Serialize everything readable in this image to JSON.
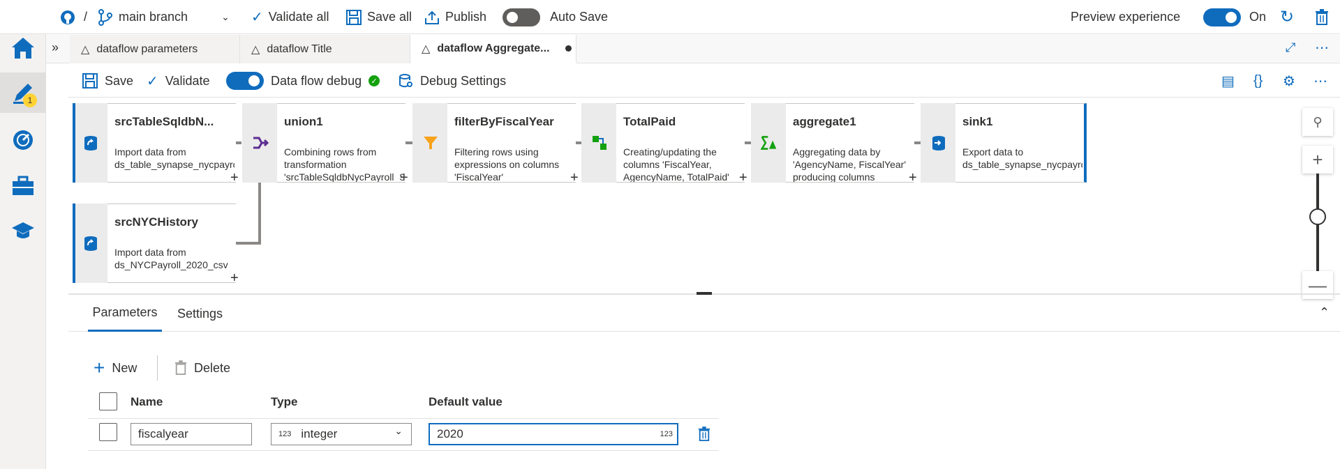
{
  "topbar": {
    "separator": "/",
    "branch": "main branch",
    "validate_all": "Validate all",
    "save_all": "Save all",
    "publish": "Publish",
    "auto_save": "Auto Save",
    "preview_experience": "Preview experience",
    "preview_state": "On"
  },
  "rail": {
    "badge_count": "1"
  },
  "tabs": [
    {
      "label": "dataflow parameters"
    },
    {
      "label": "dataflow Title"
    },
    {
      "label": "dataflow Aggregate..."
    }
  ],
  "toolbar": {
    "save": "Save",
    "validate": "Validate",
    "data_flow_debug": "Data flow debug",
    "debug_settings": "Debug Settings"
  },
  "nodes": [
    {
      "title": "srcTableSqldbN...",
      "desc": "Import data from ds_table_synapse_nycpayroll_summary"
    },
    {
      "title": "union1",
      "desc": "Combining rows from transformation 'srcTableSqldbNycPayroll_Summary, NYCHistory'"
    },
    {
      "title": "filterByFiscalYear",
      "desc": "Filtering rows using expressions on columns 'FiscalYear'"
    },
    {
      "title": "TotalPaid",
      "desc": "Creating/updating the columns 'FiscalYear, AgencyName, TotalPaid'"
    },
    {
      "title": "aggregate1",
      "desc": "Aggregating data by 'AgencyName, FiscalYear' producing columns 'TotalPaid'"
    },
    {
      "title": "sink1",
      "desc": "Export data to ds_table_synapse_nycpayroll_summary"
    },
    {
      "title": "srcNYCHistory",
      "desc": "Import data from ds_NYCPayroll_2020_csv"
    }
  ],
  "panel": {
    "tab_parameters": "Parameters",
    "tab_settings": "Settings",
    "new": "New",
    "delete": "Delete",
    "col_name": "Name",
    "col_type": "Type",
    "col_default": "Default value",
    "rows": [
      {
        "name": "fiscalyear",
        "type_badge": "123",
        "type": "integer",
        "default": "2020",
        "default_badge": "123"
      }
    ]
  },
  "colors": {
    "accent": "#0f6cbd",
    "success": "#13a10e",
    "badge": "#ffd335"
  }
}
